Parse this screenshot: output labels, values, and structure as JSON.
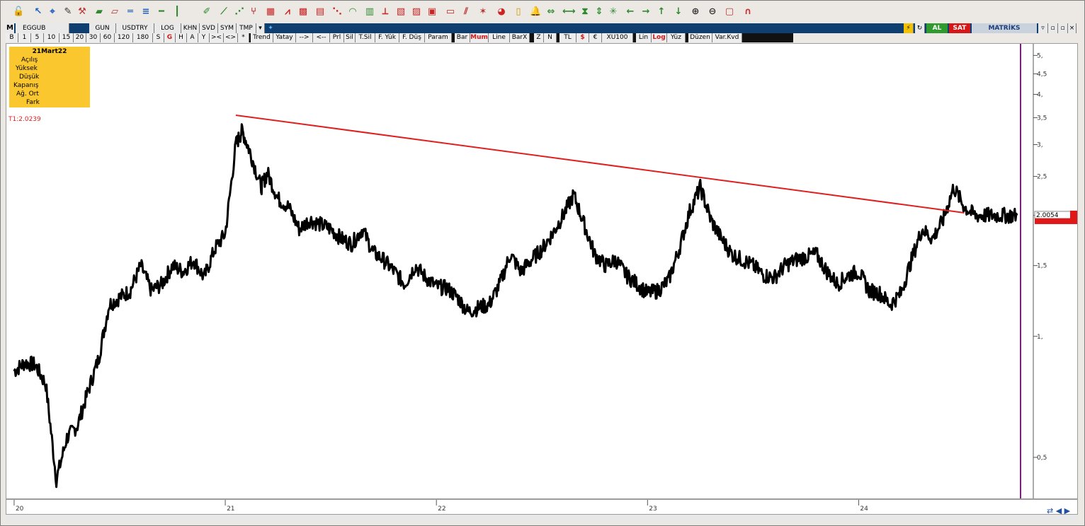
{
  "toolbar_icons": [
    "unlock-icon",
    "arrow-cursor-icon",
    "crosshair-icon",
    "edit-icon",
    "wrench-icon",
    "ruler-icon",
    "ruler-alt-icon",
    "equal-lines-icon",
    "double-lines-icon",
    "hline-icon",
    "vline-icon",
    "pen-icon",
    "diagonal-icon",
    "fan-icon",
    "fork-icon",
    "channel-icon",
    "regression-icon",
    "gann-icon",
    "fib-retrace-icon",
    "fib-fan-icon",
    "fib-arc-icon",
    "fib-time-icon",
    "speed-line-icon",
    "andrew-icon",
    "elliot-icon",
    "cycle-icon",
    "text-box-icon",
    "hatch-icon",
    "pattern-icon",
    "palette-icon",
    "note-icon",
    "bell-icon",
    "arrows-in-icon",
    "arrows-h-icon",
    "hourglass-icon",
    "arrows-v-icon",
    "star-icon",
    "arrow-left-icon",
    "arrow-right-icon",
    "arrow-up-icon",
    "arrow-down-icon",
    "zoom-in-icon",
    "zoom-out-icon",
    "picture-icon",
    "magnet-icon"
  ],
  "menu": {
    "m": "M",
    "symbol": "EGGUB",
    "period": "GUN",
    "currency": "USDTRY",
    "scale": "LOG",
    "khn": "KHN",
    "svd": "SVD",
    "sym": "SYM",
    "tmp": "TMP",
    "al": "AL",
    "sat": "SAT",
    "brand": "MATRİKS"
  },
  "period_buttons": [
    "B",
    "1",
    "5",
    "10",
    "15",
    "20",
    "30",
    "60",
    "120",
    "180",
    "S",
    "G",
    "H",
    "A",
    "Y",
    "><",
    "<>",
    "*",
    "Trend",
    "Yatay",
    "-->",
    "<--",
    "Prl",
    "Sil",
    "T.Sil",
    "F. Yük",
    "F. Düş",
    "Param",
    "Bar",
    "Mum",
    "Line",
    "BarX",
    "Z",
    "N",
    "TL",
    "$",
    "€",
    "XU100",
    "Lin",
    "Log",
    "Yüz",
    "Düzen",
    "Var.Kvd"
  ],
  "info_box": {
    "date": "21Mart22",
    "rows": [
      "Açılış",
      "Yüksek",
      "Düşük",
      "Kapanış",
      "Ağ. Ort",
      "Fark"
    ]
  },
  "trend_label": "T1:2.0239",
  "chart_data": {
    "type": "line",
    "symbol": "EGGUB",
    "scale": "log",
    "ylim": [
      0.4,
      5.3
    ],
    "y_ticks": [
      "5,",
      "4,5",
      "4,",
      "3,5",
      "3,",
      "2,5",
      "2,",
      "1,5",
      "1,",
      "0,5"
    ],
    "y_tick_values": [
      5,
      4.5,
      4,
      3.5,
      3,
      2.5,
      2,
      1.5,
      1,
      0.5
    ],
    "last_price_label": "2.0054",
    "last_price": 2.0054,
    "x_ticks": [
      "20",
      "21",
      "22",
      "23",
      "24"
    ],
    "x_tick_values": [
      2020,
      2021,
      2022,
      2023,
      2024
    ],
    "series": [
      {
        "x": [
          2020.0,
          2020.05,
          2020.1,
          2020.15,
          2020.2,
          2020.25,
          2020.3,
          2020.35,
          2020.4,
          2020.45,
          2020.5,
          2020.55,
          2020.6,
          2020.65,
          2020.7,
          2020.75,
          2020.8,
          2020.85,
          2020.9,
          2020.95,
          2021.0,
          2021.05,
          2021.08,
          2021.12,
          2021.17,
          2021.2,
          2021.25,
          2021.3,
          2021.35,
          2021.4,
          2021.45,
          2021.5,
          2021.55,
          2021.6,
          2021.65,
          2021.7,
          2021.75,
          2021.8,
          2021.85,
          2021.9,
          2021.95,
          2022.0,
          2022.05,
          2022.1,
          2022.15,
          2022.2,
          2022.25,
          2022.3,
          2022.35,
          2022.4,
          2022.45,
          2022.5,
          2022.55,
          2022.6,
          2022.65,
          2022.7,
          2022.75,
          2022.8,
          2022.85,
          2022.9,
          2022.95,
          2023.0,
          2023.05,
          2023.1,
          2023.15,
          2023.2,
          2023.25,
          2023.3,
          2023.35,
          2023.4,
          2023.45,
          2023.5,
          2023.55,
          2023.6,
          2023.65,
          2023.7,
          2023.75,
          2023.8,
          2023.85,
          2023.9,
          2023.95,
          2024.0,
          2024.05,
          2024.1,
          2024.15,
          2024.2,
          2024.25,
          2024.3,
          2024.35,
          2024.4,
          2024.45,
          2024.5,
          2024.55,
          2024.6,
          2024.65,
          2024.7,
          2024.75
        ],
        "y": [
          0.82,
          0.86,
          0.85,
          0.76,
          0.44,
          0.56,
          0.6,
          0.73,
          0.88,
          1.2,
          1.25,
          1.3,
          1.5,
          1.3,
          1.35,
          1.5,
          1.45,
          1.55,
          1.4,
          1.65,
          1.8,
          3.0,
          3.25,
          2.85,
          2.35,
          2.55,
          2.2,
          2.1,
          1.85,
          1.95,
          1.9,
          1.85,
          1.75,
          1.7,
          1.85,
          1.62,
          1.55,
          1.45,
          1.35,
          1.5,
          1.4,
          1.33,
          1.32,
          1.25,
          1.15,
          1.18,
          1.2,
          1.35,
          1.6,
          1.45,
          1.55,
          1.65,
          1.8,
          2.0,
          2.25,
          1.9,
          1.6,
          1.5,
          1.55,
          1.42,
          1.35,
          1.28,
          1.3,
          1.38,
          1.65,
          2.05,
          2.35,
          1.95,
          1.75,
          1.6,
          1.55,
          1.5,
          1.42,
          1.4,
          1.5,
          1.55,
          1.58,
          1.6,
          1.45,
          1.35,
          1.42,
          1.45,
          1.3,
          1.28,
          1.2,
          1.28,
          1.55,
          1.85,
          1.75,
          1.95,
          2.35,
          2.1,
          2.0,
          2.0,
          2.0,
          2.0,
          2.0
        ]
      }
    ],
    "trendline": {
      "x": [
        2021.05,
        2024.5
      ],
      "y": [
        3.55,
        2.03
      ],
      "color": "#e02020"
    },
    "vertical_marker_color": "#7a1f7a",
    "grid": false
  }
}
